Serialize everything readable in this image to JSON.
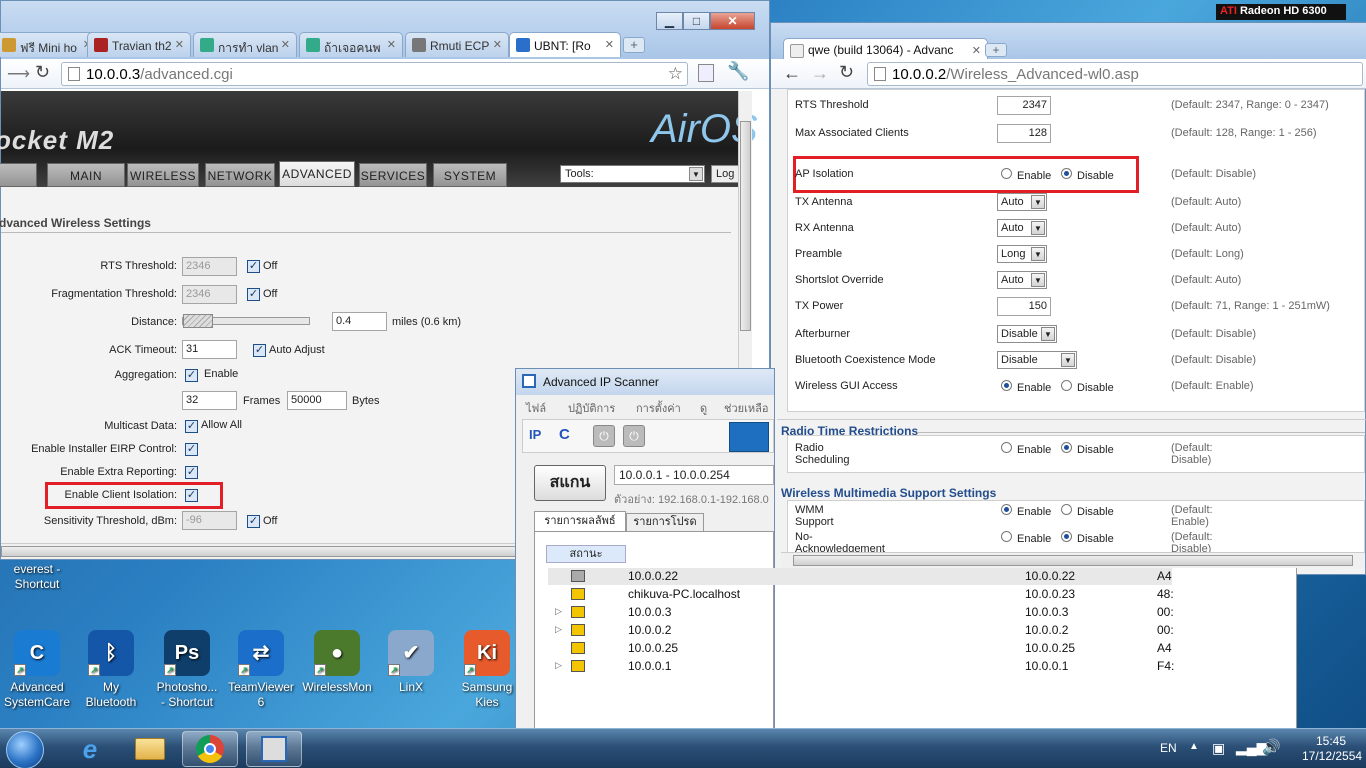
{
  "desktop": {
    "icons": [
      {
        "name": "everest-shortcut",
        "label": "everest -\nShortcut",
        "color": "#d38b1a",
        "glyph": "e"
      },
      {
        "name": "advanced-systemcare",
        "label": "Advanced\nSystemCare",
        "color": "#1a7bd3",
        "glyph": "C"
      },
      {
        "name": "my-bluetooth",
        "label": "My\nBluetooth",
        "color": "#1456a8",
        "glyph": "ᛒ"
      },
      {
        "name": "photoshop-shortcut",
        "label": "Photosho...\n- Shortcut",
        "color": "#0f3e6a",
        "glyph": "Ps"
      },
      {
        "name": "teamviewer",
        "label": "TeamViewer\n6",
        "color": "#1b6ec9",
        "glyph": "⇄"
      },
      {
        "name": "wirelessmon",
        "label": "WirelessMon",
        "color": "#4b7a2c",
        "glyph": "●"
      },
      {
        "name": "linx",
        "label": "LinX",
        "color": "#8aa8cc",
        "glyph": "✔"
      },
      {
        "name": "samsung-kies",
        "label": "Samsung\nKies",
        "color": "#e65a2b",
        "glyph": "Ki"
      }
    ],
    "gpu_badge": "Radeon HD 6300"
  },
  "taskbar": {
    "lang": "EN",
    "time": "15:45",
    "date": "17/12/2554"
  },
  "left_browser": {
    "tabs": [
      {
        "label": "ฟรี Mini ho",
        "color": "#c93"
      },
      {
        "label": "Travian th2",
        "color": "#a22"
      },
      {
        "label": "การทำ vlan",
        "color": "#3a8"
      },
      {
        "label": "ถ้าเจอคนพ",
        "color": "#3a8"
      },
      {
        "label": "Rmuti ECP",
        "color": "#777"
      },
      {
        "label": "UBNT: [Ro",
        "color": "#2a6fc9"
      }
    ],
    "url_host": "10.0.0.3",
    "url_path": "/advanced.cgi",
    "brand": "ocket M2",
    "airos": "AirOS",
    "nav": [
      "MAIN",
      "WIRELESS",
      "NETWORK",
      "ADVANCED",
      "SERVICES",
      "SYSTEM"
    ],
    "tools_label": "Tools:",
    "logout": "Log",
    "section_title": "dvanced Wireless Settings",
    "fields": {
      "rts_label": "RTS Threshold:",
      "rts_value": "2346",
      "off": "Off",
      "frag_label": "Fragmentation Threshold:",
      "frag_value": "2346",
      "distance_label": "Distance:",
      "distance_value": "0.4",
      "distance_unit": "miles (0.6 km)",
      "ack_label": "ACK Timeout:",
      "ack_value": "31",
      "auto_adjust": "Auto Adjust",
      "agg_label": "Aggregation:",
      "enable": "Enable",
      "frames_value": "32",
      "frames": "Frames",
      "bytes_value": "50000",
      "bytes": "Bytes",
      "mcast_label": "Multicast Data:",
      "allow_all": "Allow All",
      "eirp_label": "Enable Installer EIRP Control:",
      "extra_label": "Enable Extra Reporting:",
      "client_iso_label": "Enable Client Isolation:",
      "sens_label": "Sensitivity Threshold, dBm:",
      "sens_value": "-96"
    }
  },
  "right_browser": {
    "tab_label": "qwe (build 13064) - Advanc",
    "url_host": "10.0.0.2",
    "url_path": "/Wireless_Advanced-wl0.asp",
    "rows": [
      {
        "label": "RTS Threshold",
        "type": "input",
        "value": "2347",
        "def": "(Default: 2347, Range: 0 - 2347)"
      },
      {
        "label": "Max Associated Clients",
        "type": "input",
        "value": "128",
        "def": "(Default: 128, Range: 1 - 256)"
      },
      {
        "label": "AP Isolation",
        "type": "radio",
        "sel": "disable",
        "def": "(Default: Disable)"
      },
      {
        "label": "TX Antenna",
        "type": "select",
        "value": "Auto",
        "def": "(Default: Auto)"
      },
      {
        "label": "RX Antenna",
        "type": "select",
        "value": "Auto",
        "def": "(Default: Auto)"
      },
      {
        "label": "Preamble",
        "type": "select",
        "value": "Long",
        "def": "(Default: Long)"
      },
      {
        "label": "Shortslot Override",
        "type": "select",
        "value": "Auto",
        "def": "(Default: Auto)"
      },
      {
        "label": "TX Power",
        "type": "input",
        "value": "150",
        "def": "(Default: 71, Range: 1 - 251mW)"
      },
      {
        "label": "Afterburner",
        "type": "select",
        "value": "Disable",
        "def": "(Default: Disable)"
      },
      {
        "label": "Bluetooth Coexistence Mode",
        "type": "select",
        "value": "Disable",
        "def": "(Default: Disable)"
      },
      {
        "label": "Wireless GUI Access",
        "type": "radio",
        "sel": "enable",
        "def": "(Default: Enable)"
      }
    ],
    "sect2": "Radio Time Restrictions",
    "radio_sched": {
      "label": "Radio Scheduling",
      "sel": "disable",
      "def": "(Default: Disable)"
    },
    "sect3": "Wireless Multimedia Support Settings",
    "wmm": {
      "label": "WMM Support",
      "sel": "enable",
      "def": "(Default: Enable)"
    },
    "noack": {
      "label": "No-Acknowledgement",
      "sel": "disable",
      "def": "(Default: Disable)"
    },
    "enable": "Enable",
    "disable": "Disable"
  },
  "ipscanner": {
    "title": "Advanced IP Scanner",
    "menu": [
      "ไฟล์",
      "ปฏิบัติการ",
      "การตั้งค่า",
      "ดู",
      "ช่วยเหลือ"
    ],
    "scan_button": "สแกน",
    "range": "10.0.0.1 - 10.0.0.254",
    "example": "ตัวอย่าง: 192.168.0.1-192.168.0",
    "tab_results": "รายการผลลัพธ์",
    "tab_favs": "รายการโปรด",
    "col_status": "สถานะ",
    "rows": [
      {
        "name": "10.0.0.22",
        "ip": "10.0.0.22",
        "mac": "A4"
      },
      {
        "name": "chikuva-PC.localhost",
        "ip": "10.0.0.23",
        "mac": "48:"
      },
      {
        "name": "10.0.0.3",
        "ip": "10.0.0.3",
        "mac": "00:"
      },
      {
        "name": "10.0.0.2",
        "ip": "10.0.0.2",
        "mac": "00:"
      },
      {
        "name": "10.0.0.25",
        "ip": "10.0.0.25",
        "mac": "A4"
      },
      {
        "name": "10.0.0.1",
        "ip": "10.0.0.1",
        "mac": "F4:"
      }
    ]
  }
}
